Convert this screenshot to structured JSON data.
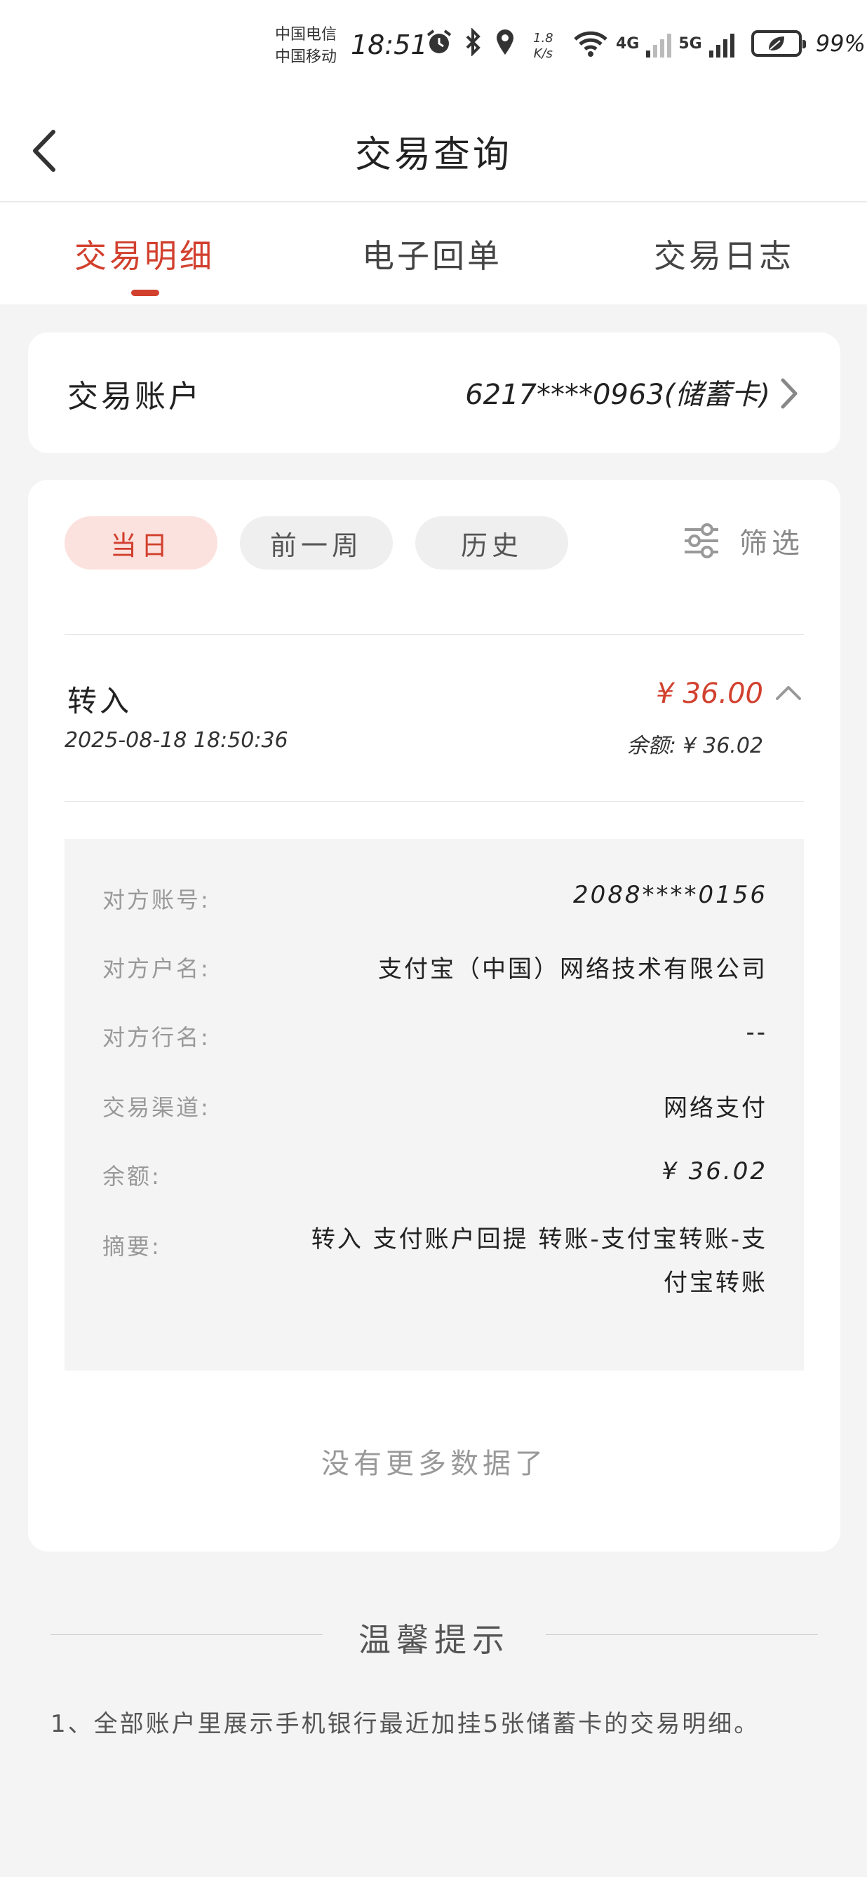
{
  "status_bar": {
    "carrier_1": "中国电信",
    "carrier_2": "中国移动",
    "time": "18:51",
    "speed_value": "1.8",
    "speed_unit": "K/s",
    "net_4g": "4G",
    "net_5g": "5G",
    "battery": "99%"
  },
  "header": {
    "title": "交易查询"
  },
  "tabs": [
    {
      "label": "交易明细"
    },
    {
      "label": "电子回单"
    },
    {
      "label": "交易日志"
    }
  ],
  "account": {
    "label": "交易账户",
    "value": "6217****0963(储蓄卡)"
  },
  "filters": {
    "chips": [
      {
        "label": "当日"
      },
      {
        "label": "前一周"
      },
      {
        "label": "历史"
      }
    ],
    "filter_label": "筛选"
  },
  "transaction": {
    "type": "转入",
    "datetime": "2025-08-18 18:50:36",
    "amount": "¥ 36.00",
    "balance": "余额: ¥ 36.02",
    "details": [
      {
        "label": "对方账号:",
        "value": "2088****0156"
      },
      {
        "label": "对方户名:",
        "value": "支付宝（中国）网络技术有限公司"
      },
      {
        "label": "对方行名:",
        "value": "--"
      },
      {
        "label": "交易渠道:",
        "value": "网络支付"
      },
      {
        "label": "余额:",
        "value": "¥ 36.02"
      },
      {
        "label": "摘要:",
        "value": "转入 支付账户回提 转账-支付宝转账-支付宝转账"
      }
    ]
  },
  "no_more": "没有更多数据了",
  "tips": {
    "title": "温馨提示",
    "text": "1、全部账户里展示手机银行最近加挂5张储蓄卡的交易明细。"
  },
  "colors": {
    "accent": "#d2402e",
    "chip_active_bg": "#fbe2df",
    "page_bg": "#f4f4f4"
  }
}
